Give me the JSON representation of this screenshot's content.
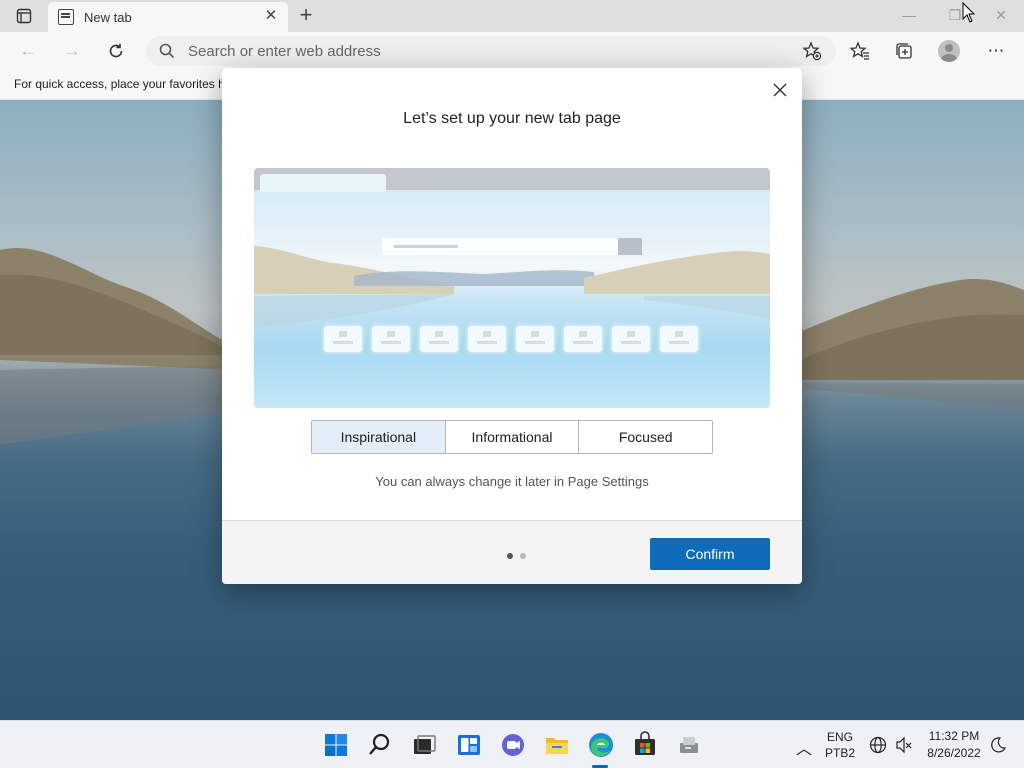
{
  "browser": {
    "tab_title": "New tab",
    "address_placeholder": "Search or enter web address",
    "favorites_hint": "For quick access, place your favorites h"
  },
  "dialog": {
    "title": "Let’s set up your new tab page",
    "options": [
      "Inspirational",
      "Informational",
      "Focused"
    ],
    "selected_option": "Inspirational",
    "hint": "You can always change it later in Page Settings",
    "confirm_label": "Confirm",
    "page_indicator": {
      "total": 2,
      "current": 1
    }
  },
  "taskbar": {
    "language": "ENG",
    "keyboard": "PTB2",
    "time": "11:32 PM",
    "date": "8/26/2022",
    "pinned_apps": [
      "start-icon",
      "search-icon",
      "task-view-icon",
      "widgets-icon",
      "chat-icon",
      "file-explorer-icon",
      "edge-icon",
      "store-icon",
      "app-icon"
    ],
    "active_app": "edge-icon"
  },
  "colors": {
    "accent": "#0f6cbd",
    "selected_segment": "#e4eef8"
  }
}
